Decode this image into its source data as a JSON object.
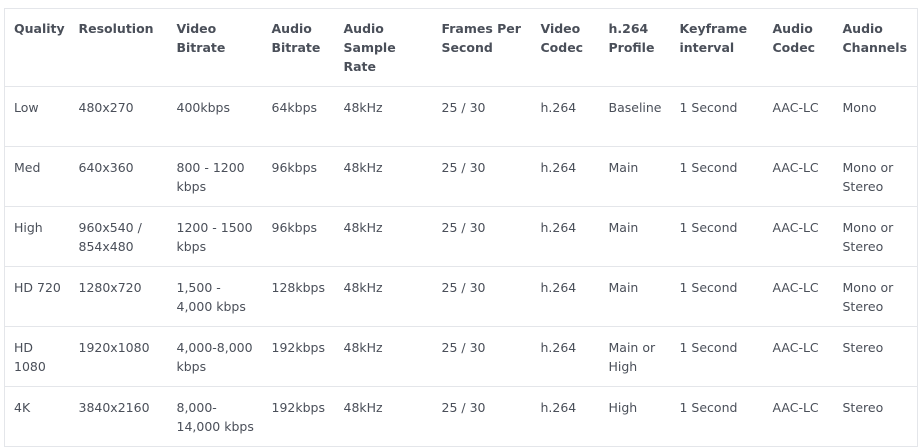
{
  "table": {
    "headers": [
      "Quality",
      "Resolution",
      "Video Bitrate",
      "Audio Bitrate",
      "Audio Sample Rate",
      "Frames Per Second",
      "Video Codec",
      "h.264 Profile",
      "Keyframe interval",
      "Audio Codec",
      "Audio Channels"
    ],
    "rows": [
      [
        "Low",
        "480x270",
        "400kbps",
        "64kbps",
        "48kHz",
        "25 / 30",
        "h.264",
        "Baseline",
        "1 Second",
        "AAC-LC",
        "Mono"
      ],
      [
        "Med",
        "640x360",
        "800 - 1200 kbps",
        "96kbps",
        "48kHz",
        "25 / 30",
        "h.264",
        "Main",
        "1 Second",
        "AAC-LC",
        "Mono or Stereo"
      ],
      [
        "High",
        "960x540 / 854x480",
        "1200 - 1500 kbps",
        "96kbps",
        "48kHz",
        "25 / 30",
        "h.264",
        "Main",
        "1 Second",
        "AAC-LC",
        "Mono or Stereo"
      ],
      [
        "HD 720",
        "1280x720",
        "1,500 - 4,000 kbps",
        "128kbps",
        "48kHz",
        "25 / 30",
        "h.264",
        "Main",
        "1 Second",
        "AAC-LC",
        "Mono or Stereo"
      ],
      [
        "HD 1080",
        "1920x1080",
        "4,000-8,000 kbps",
        "192kbps",
        "48kHz",
        "25 / 30",
        "h.264",
        "Main or High",
        "1 Second",
        "AAC-LC",
        "Stereo"
      ],
      [
        "4K",
        "3840x2160",
        "8,000- 14,000 kbps",
        "192kbps",
        "48kHz",
        "25 / 30",
        "h.264",
        "High",
        "1 Second",
        "AAC-LC",
        "Stereo"
      ]
    ]
  }
}
